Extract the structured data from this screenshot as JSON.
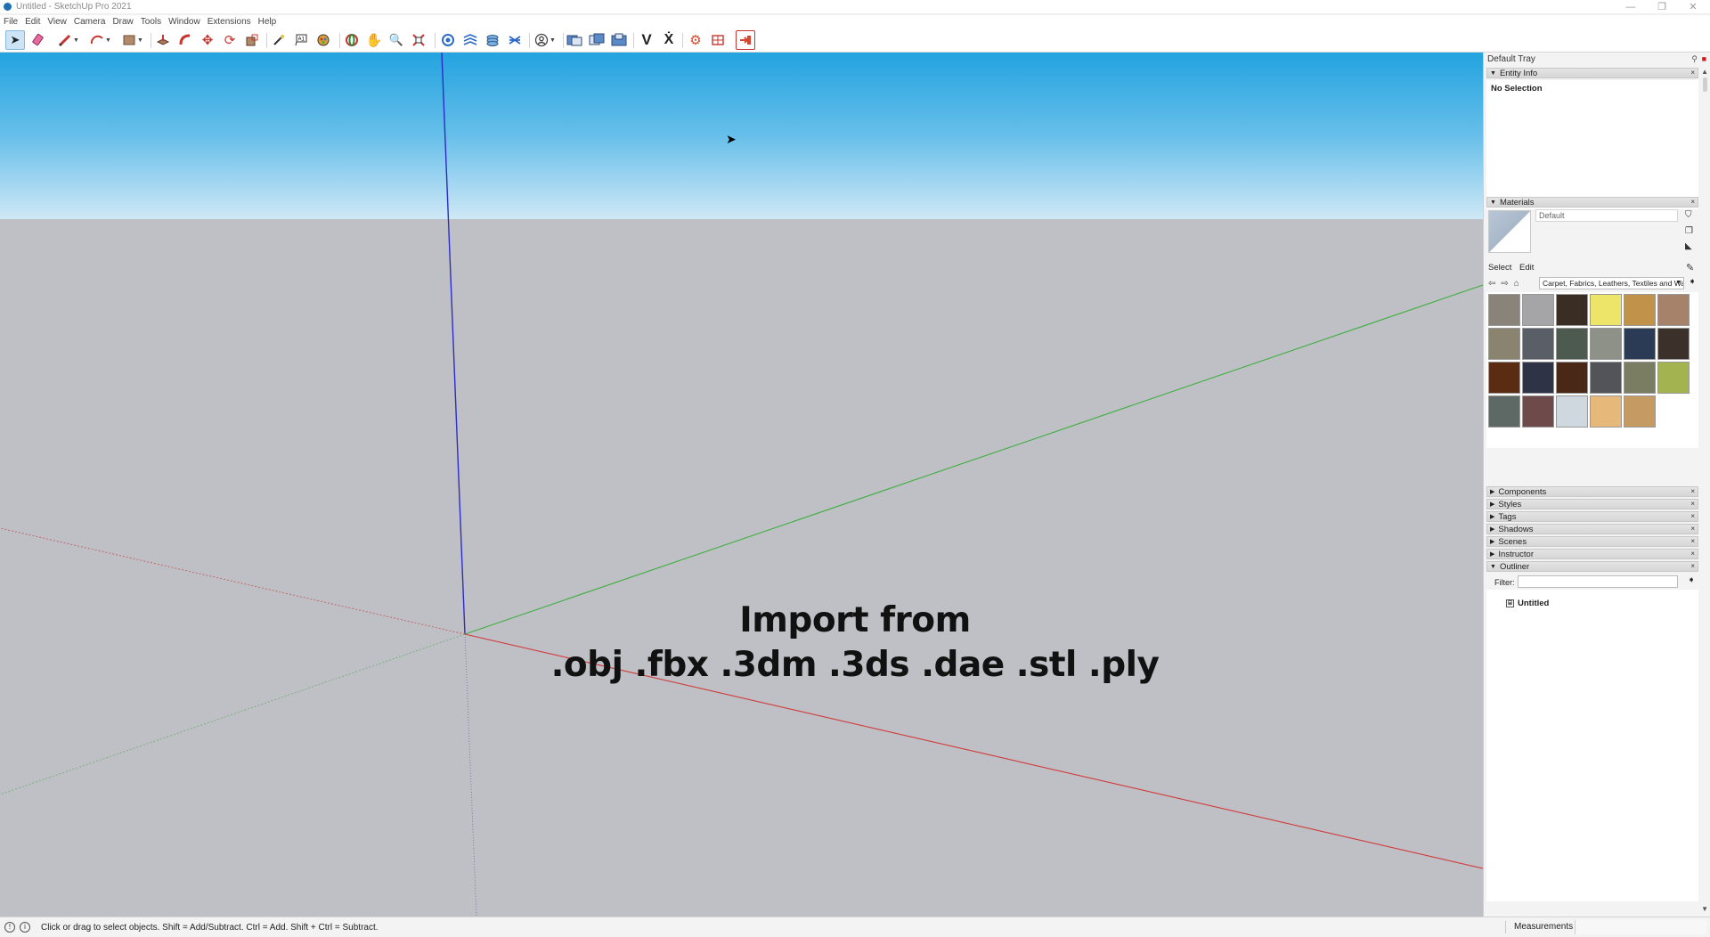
{
  "window": {
    "title": "Untitled - SketchUp Pro 2021",
    "minimize_glyph": "—",
    "restore_glyph": "❐",
    "close_glyph": "✕"
  },
  "menu": [
    "File",
    "Edit",
    "View",
    "Camera",
    "Draw",
    "Tools",
    "Window",
    "Extensions",
    "Help"
  ],
  "toolbar": {
    "icons": [
      "select-icon",
      "eraser-icon",
      "line-pencil-icon",
      "arc-icon",
      "rectangle-icon",
      "push-pull-icon",
      "follow-me-icon",
      "move-icon",
      "rotate-icon",
      "scale-icon",
      "tape-measure-icon",
      "text-icon",
      "paint-bucket-icon",
      "orbit-icon",
      "pan-icon",
      "zoom-icon",
      "zoom-extents-icon",
      "section-plane-icon",
      "sandbox-icon",
      "layers-icon",
      "extension-icon",
      "account-icon",
      "warehouse-icon",
      "share-model-icon",
      "extension-warehouse-icon",
      "vray-icon",
      "vray-light-icon",
      "settings-gear-icon",
      "export-icon",
      "import-icon"
    ]
  },
  "viewport": {
    "overlay_line1": "Import from",
    "overlay_line2": ".obj .fbx .3dm .3ds .dae .stl .ply",
    "sky_color": "#23a3e0",
    "ground_color": "#bfc0c5",
    "axis_colors": {
      "red": "#d23a3a",
      "green": "#3fae3f",
      "blue": "#2c2cc8"
    }
  },
  "tray": {
    "title": "Default Tray",
    "entity_info": {
      "header": "Entity Info",
      "selection": "No Selection"
    },
    "materials": {
      "header": "Materials",
      "current": "Default",
      "tabs": [
        "Select",
        "Edit"
      ],
      "library": "Carpet, Fabrics, Leathers, Textiles and Wallpaper",
      "swatch_colors": [
        "#8a8379",
        "#a5a5a8",
        "#3a2e24",
        "#ece56a",
        "#c0924a",
        "#a7826a",
        "#8a8370",
        "#5a5e66",
        "#4d5a50",
        "#8d9187",
        "#2b3a55",
        "#3b312a",
        "#5a2c12",
        "#2f3346",
        "#4a2818",
        "#52545a",
        "#7b7d62",
        "#a2b350",
        "#5e6865",
        "#6e4b4a",
        "#cfd7df",
        "#e6b87a",
        "#c59a63"
      ]
    },
    "collapsed_panels": [
      "Components",
      "Styles",
      "Tags",
      "Shadows",
      "Scenes",
      "Instructor"
    ],
    "outliner": {
      "header": "Outliner",
      "filter_label": "Filter:",
      "root": "Untitled"
    }
  },
  "status": {
    "hint": "Click or drag to select objects. Shift = Add/Subtract. Ctrl = Add. Shift + Ctrl = Subtract.",
    "measurements_label": "Measurements"
  }
}
